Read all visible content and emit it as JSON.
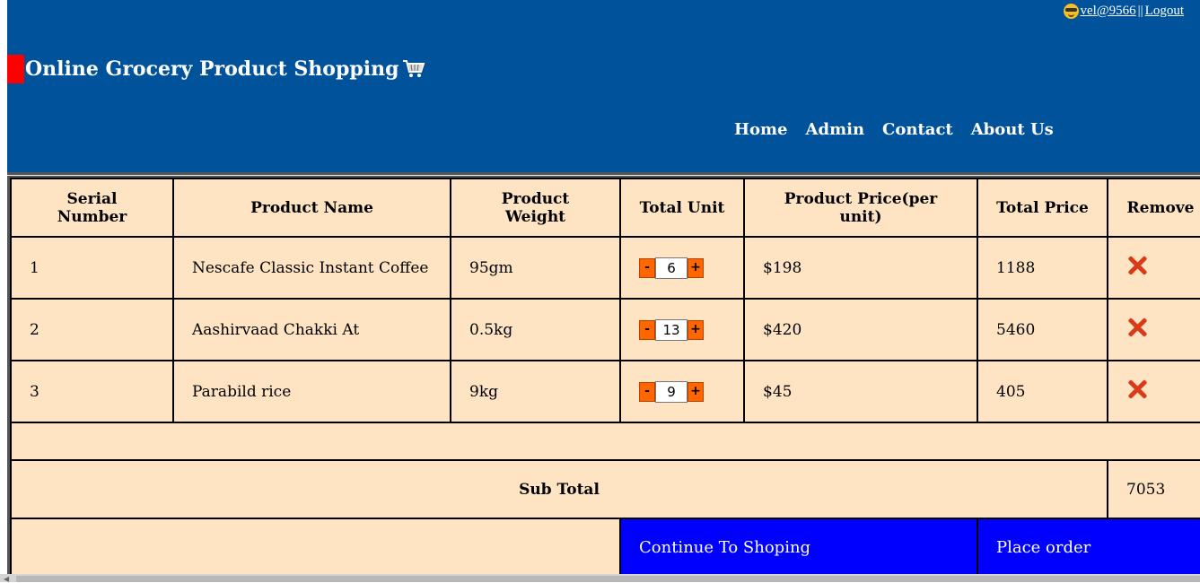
{
  "header": {
    "user_link": "vel@9566",
    "separator": "||",
    "logout": "Logout",
    "title": "Online Grocery Product Shopping",
    "nav": [
      "Home",
      "Admin",
      "Contact",
      "About Us"
    ]
  },
  "table": {
    "columns": [
      "Serial Number",
      "Product Name",
      "Product Weight",
      "Total Unit",
      "Product Price(per unit)",
      "Total Price",
      "Remove"
    ],
    "rows": [
      {
        "serial": "1",
        "name": "Nescafe Classic Instant Coffee",
        "weight": "95gm",
        "unit": "6",
        "price": "$198",
        "total": "1188"
      },
      {
        "serial": "2",
        "name": "Aashirvaad Chakki At",
        "weight": "0.5kg",
        "unit": "13",
        "price": "$420",
        "total": "5460"
      },
      {
        "serial": "3",
        "name": "Parabild rice",
        "weight": "9kg",
        "unit": "9",
        "price": "$45",
        "total": "405"
      }
    ],
    "stepper_minus": "-",
    "stepper_plus": "+",
    "subtotal_label": "Sub Total",
    "subtotal_value": "7053",
    "continue_label": "Continue To Shoping",
    "order_label": "Place order"
  },
  "colors": {
    "header_bg": "#00529b",
    "table_bg": "#ffe4c4",
    "action_bg": "#0000ff",
    "stepper": "#ff6600",
    "accent": "#ff0000"
  }
}
